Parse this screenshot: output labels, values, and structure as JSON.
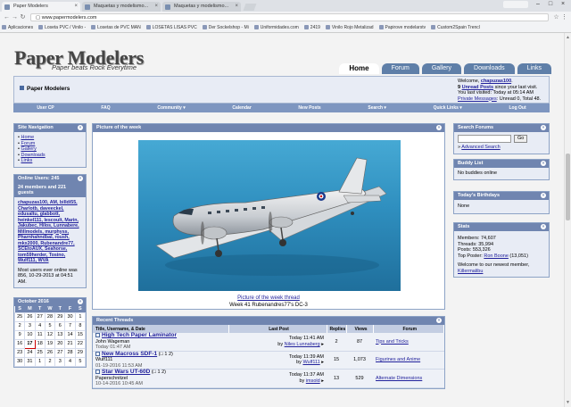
{
  "browser": {
    "tabs": [
      {
        "label": "Paper Modelers",
        "active": true
      },
      {
        "label": "Maquetas y modelismo...",
        "active": false
      },
      {
        "label": "Maquetas y modelismo...",
        "active": false
      }
    ],
    "url": "www.papermodelers.com",
    "bookmarks": [
      "Aplicaciones",
      "Loseta PVC / Vinilo -",
      "Losetas de PVC MAN",
      "LOSETAS LISAS PVC",
      "Der Sockelshop - Mi",
      "Uniformidades.com",
      "2419",
      "Vinilo Rojo Metalizad",
      "Papirove modelarstv",
      "Custom2Spain Trencl"
    ]
  },
  "site": {
    "logo": "Paper Modelers",
    "tagline": "Paper beats Rock Everytime",
    "nav": [
      "Home",
      "Forum",
      "Gallery",
      "Downloads",
      "Links"
    ],
    "crumb": "Paper Modelers",
    "welcome": {
      "line1_prefix": "Welcome, ",
      "user": "chapuzas100",
      "line1_suffix": ".",
      "pm_count": "9",
      "pm_label": "Unread Posts",
      "pm_suffix": " since your last visit.",
      "last_visit": "You last visited: Today at 05:14 AM",
      "pm_prefix": "Private Messages",
      "pm_stats": ": Unread 0, Total 48."
    },
    "menu": [
      "User CP",
      "FAQ",
      "Community ▾",
      "Calendar",
      "New Posts",
      "Search ▾",
      "Quick Links ▾",
      "Log Out"
    ]
  },
  "left": {
    "site_nav": {
      "title": "Site Navigation",
      "links": [
        "Home",
        "Forum",
        "Gallery",
        "Downloads",
        "Links"
      ]
    },
    "online": {
      "title": "Online Users: 245",
      "sub": "24 members and 221 guests",
      "names": "chapuzas100, AM, billdi55, Charlotb, daveeckel, edusaltu, glabbott, heinkel111, lescoult, Marin, Jakubec, Hilos, Lunnabere, Millmodels, murphyss, Pharnhahndbal, roush, mkx2000, Rubenandre77, SCEtoAUX, Seahorse, tom59herder, Tosino, Wulf111, WVA",
      "most": "Most users ever online was 856, 10-29-2013 at 04:51 AM."
    },
    "calendar": {
      "title": "October 2016",
      "days": [
        "S",
        "M",
        "T",
        "W",
        "T",
        "F",
        "S"
      ],
      "weeks": [
        [
          "25",
          "26",
          "27",
          "28",
          "29",
          "30",
          "1"
        ],
        [
          "2",
          "3",
          "4",
          "5",
          "6",
          "7",
          "8"
        ],
        [
          "9",
          "10",
          "11",
          "12",
          "13",
          "14",
          "15"
        ],
        [
          "16",
          "17",
          "18",
          "19",
          "20",
          "21",
          "22"
        ],
        [
          "23",
          "24",
          "25",
          "26",
          "27",
          "28",
          "29"
        ],
        [
          "30",
          "31",
          "1",
          "2",
          "3",
          "4",
          "5"
        ]
      ],
      "today": "17"
    }
  },
  "center": {
    "potw": {
      "title": "Picture of the week",
      "link": "Picture of the week thread",
      "caption": "Week 41 Rubenandres77's DC-3"
    },
    "recent": {
      "title": "Recent Threads",
      "columns": [
        "Title, Username, & Date",
        "Last Post",
        "Replies",
        "Views",
        "Forum"
      ],
      "rows": [
        {
          "title": "High Tech Paper Laminator",
          "user": "John Wageman",
          "date": "Today 01:47 AM",
          "pages": "",
          "last_time": "Today 11:41 AM",
          "last_by": "Niles Lunnaberg",
          "replies": "2",
          "views": "87",
          "forum": "Tips and Tricks"
        },
        {
          "title": "New Macross SDF-1",
          "user": "Wulf111",
          "date": "01-19-2016 11:53 AM",
          "pages": "(□ 1 2)",
          "last_time": "Today 11:39 AM",
          "last_by": "Wulf111",
          "replies": "15",
          "views": "1,073",
          "forum": "Figurines and Anime"
        },
        {
          "title": "Star Wars UT-60D",
          "user": "Paperschnitzel",
          "date": "10-14-2016 10:45 AM",
          "pages": "(□ 1 2)",
          "last_time": "Today 11:37 AM",
          "last_by": "imsold",
          "replies": "13",
          "views": "529",
          "forum": "Alternate Dimensions"
        }
      ]
    }
  },
  "right": {
    "search": {
      "title": "Search Forums",
      "go": "Go",
      "advanced": "Advanced Search"
    },
    "buddy": {
      "title": "Buddy List",
      "text": "No buddies online"
    },
    "birthdays": {
      "title": "Today's Birthdays",
      "text": "None"
    },
    "stats": {
      "title": "Stats",
      "members_label": "Members:",
      "members": "74,607",
      "threads_label": "Threads:",
      "threads": "35,994",
      "posts_label": "Posts:",
      "posts": "553,326",
      "top_label": "Top Poster:",
      "top": "Ron Boone",
      "top_count": "(13,051)",
      "newest_prefix": "Welcome to our newest member,",
      "newest": "Killermalibu"
    }
  }
}
